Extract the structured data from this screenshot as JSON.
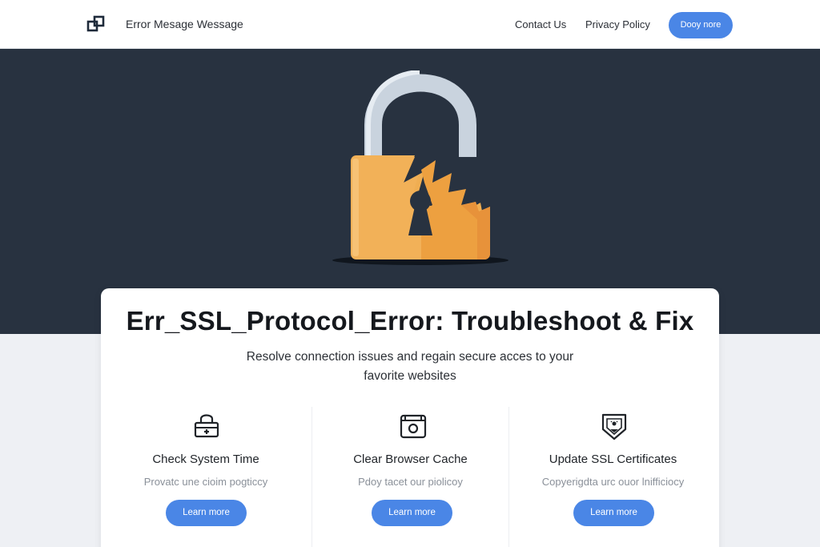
{
  "header": {
    "site_title": "Error Mesage Wessage",
    "nav": [
      {
        "label": "Contact Us"
      },
      {
        "label": "Privacy Policy"
      }
    ],
    "cta_label": "Dooy nore",
    "logo_icon": "overlapping-squares-icon"
  },
  "hero": {
    "illustration": "broken-padlock-icon"
  },
  "card": {
    "title": "Err_SSL_Protocol_Error: Troubleshoot & Fix",
    "subtitle": "Resolve connection issues and regain secure acces to your favorite websites",
    "columns": [
      {
        "icon": "lock-toolbox-icon",
        "heading": "Check System Time",
        "description": "Provatc une cioim pogticcy",
        "button_label": "Learn more"
      },
      {
        "icon": "camera-box-icon",
        "heading": "Clear Browser Cache",
        "description": "Pdoy tacet our piolicoy",
        "button_label": "Learn more"
      },
      {
        "icon": "shield-certificate-icon",
        "heading": "Update SSL Certificates",
        "description": "Copyerigdta urc ouor lnifficiocy",
        "button_label": "Learn more"
      }
    ]
  },
  "colors": {
    "accent": "#4a86e6",
    "hero_bg": "#283240",
    "lock_body": "#f0ae52",
    "lock_shackle": "#c9d3de"
  }
}
